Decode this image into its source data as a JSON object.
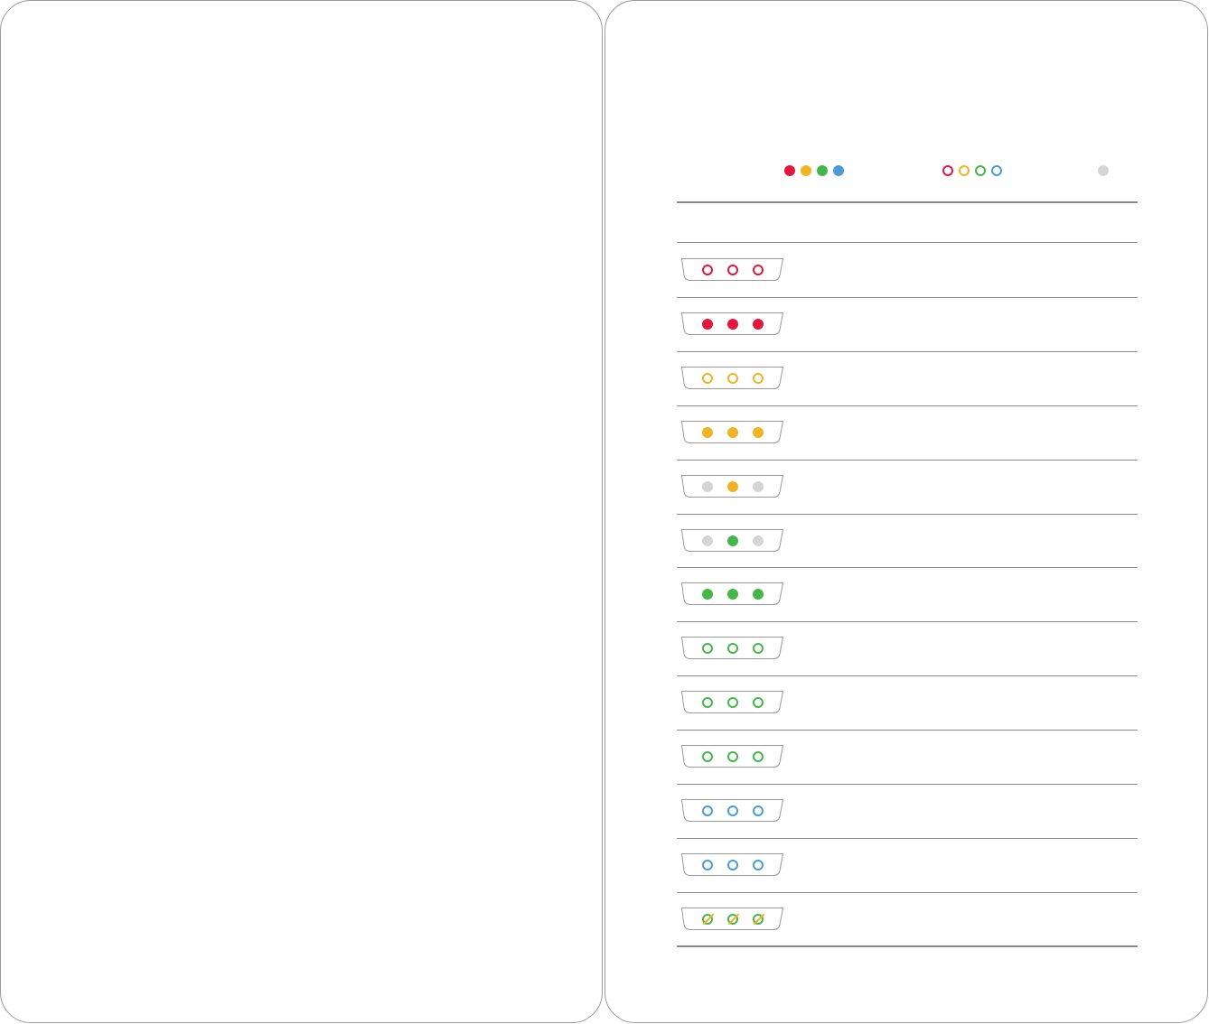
{
  "colors": {
    "red": "#e3173e",
    "yellow": "#f0b323",
    "green": "#45b649",
    "blue": "#4a9bd8",
    "gray": "#d5d5d5",
    "border": "#9a9a9a",
    "rule": "#8a8a8a"
  },
  "legend": {
    "solid": [
      "red",
      "yellow",
      "green",
      "blue"
    ],
    "outline": [
      "red",
      "yellow",
      "green",
      "blue"
    ],
    "off": [
      "gray"
    ]
  },
  "led_states": [
    {
      "leds": [
        {
          "color": "red",
          "style": "outline"
        },
        {
          "color": "red",
          "style": "outline"
        },
        {
          "color": "red",
          "style": "outline"
        }
      ]
    },
    {
      "leds": [
        {
          "color": "red",
          "style": "solid"
        },
        {
          "color": "red",
          "style": "solid"
        },
        {
          "color": "red",
          "style": "solid"
        }
      ]
    },
    {
      "leds": [
        {
          "color": "yellow",
          "style": "outline"
        },
        {
          "color": "yellow",
          "style": "outline"
        },
        {
          "color": "yellow",
          "style": "outline"
        }
      ]
    },
    {
      "leds": [
        {
          "color": "yellow",
          "style": "solid"
        },
        {
          "color": "yellow",
          "style": "solid"
        },
        {
          "color": "yellow",
          "style": "solid"
        }
      ]
    },
    {
      "leds": [
        {
          "color": "gray",
          "style": "solid"
        },
        {
          "color": "yellow",
          "style": "solid"
        },
        {
          "color": "gray",
          "style": "solid"
        }
      ]
    },
    {
      "leds": [
        {
          "color": "gray",
          "style": "solid"
        },
        {
          "color": "green",
          "style": "solid"
        },
        {
          "color": "gray",
          "style": "solid"
        }
      ]
    },
    {
      "leds": [
        {
          "color": "green",
          "style": "solid"
        },
        {
          "color": "green",
          "style": "solid"
        },
        {
          "color": "green",
          "style": "solid"
        }
      ]
    },
    {
      "leds": [
        {
          "color": "green",
          "style": "outline"
        },
        {
          "color": "green",
          "style": "outline"
        },
        {
          "color": "green",
          "style": "outline"
        }
      ]
    },
    {
      "leds": [
        {
          "color": "green",
          "style": "outline"
        },
        {
          "color": "green",
          "style": "outline"
        },
        {
          "color": "green",
          "style": "outline"
        }
      ]
    },
    {
      "leds": [
        {
          "color": "green",
          "style": "outline"
        },
        {
          "color": "green",
          "style": "outline"
        },
        {
          "color": "green",
          "style": "outline"
        }
      ]
    },
    {
      "leds": [
        {
          "color": "blue",
          "style": "outline"
        },
        {
          "color": "blue",
          "style": "outline"
        },
        {
          "color": "blue",
          "style": "outline"
        }
      ]
    },
    {
      "leds": [
        {
          "color": "blue",
          "style": "outline"
        },
        {
          "color": "blue",
          "style": "outline"
        },
        {
          "color": "blue",
          "style": "outline"
        }
      ]
    },
    {
      "leds": [
        {
          "color": "green",
          "style": "outline",
          "slash": "yellow"
        },
        {
          "color": "green",
          "style": "outline",
          "slash": "yellow"
        },
        {
          "color": "green",
          "style": "outline",
          "slash": "yellow"
        }
      ]
    }
  ]
}
